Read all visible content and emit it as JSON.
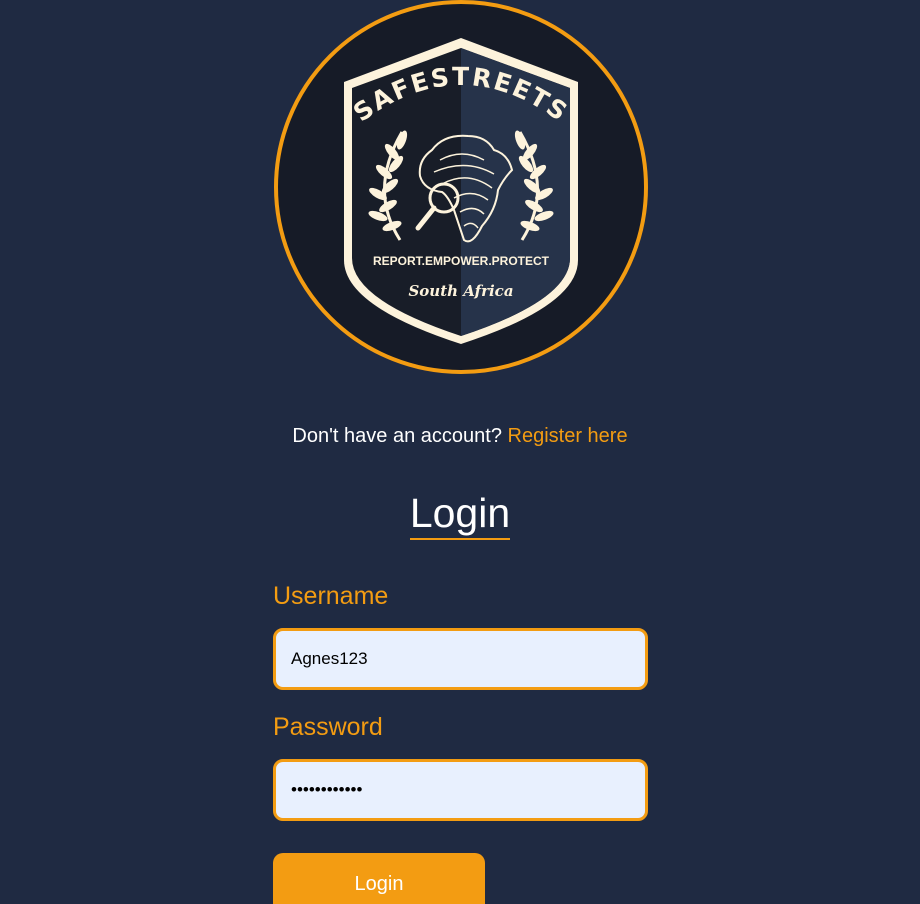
{
  "logo": {
    "arc_text": "SAFESTREETS",
    "tagline": "REPORT.EMPOWER.PROTECT",
    "country": "South Africa",
    "ring_color": "#f39c12",
    "shield_color": "#fdf3dc"
  },
  "register": {
    "prompt": "Don't have an account?",
    "link": "Register here"
  },
  "form": {
    "title": "Login",
    "username_label": "Username",
    "username_value": "Agnes123",
    "password_label": "Password",
    "password_value": "••••••••••••",
    "submit_label": "Login"
  },
  "colors": {
    "background": "#1f2a42",
    "accent": "#f39c12",
    "input_bg": "#e8f0fe"
  }
}
